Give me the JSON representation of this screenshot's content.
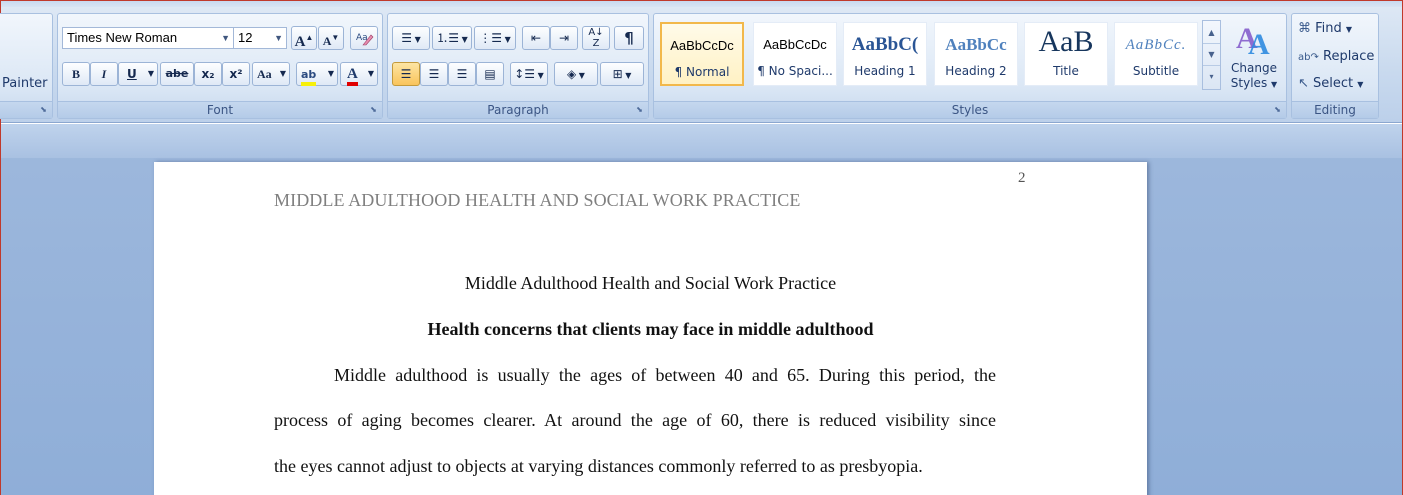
{
  "ribbon": {
    "clipboard": {
      "format_painter_label": "Painter"
    },
    "font": {
      "label": "Font",
      "font_name": "Times New Roman",
      "font_size": "12",
      "grow_label": "A",
      "shrink_label": "A",
      "bold_label": "B",
      "italic_label": "I",
      "underline_label": "U",
      "strikethrough_label": "abe",
      "subscript_label": "x₂",
      "superscript_label": "x²",
      "change_case_label": "Aa",
      "highlight_label": "ab",
      "font_color_label": "A",
      "highlight_color": "#f7f00a",
      "font_color": "#e00000"
    },
    "paragraph": {
      "label": "Paragraph",
      "pilcrow_label": "¶"
    },
    "styles": {
      "label": "Styles",
      "items": [
        {
          "sample": "AaBbCcDc",
          "name": "¶ Normal"
        },
        {
          "sample": "AaBbCcDc",
          "name": "¶ No Spaci..."
        },
        {
          "sample": "AaBbC(",
          "name": "Heading 1"
        },
        {
          "sample": "AaBbCc",
          "name": "Heading 2"
        },
        {
          "sample": "AaB",
          "name": "Title"
        },
        {
          "sample": "AaBbCc.",
          "name": "Subtitle"
        }
      ],
      "change_styles_line1": "Change",
      "change_styles_line2": "Styles"
    },
    "editing": {
      "label": "Editing",
      "find_label": "Find",
      "replace_label": "Replace",
      "select_label": "Select"
    }
  },
  "document": {
    "page_number": "2",
    "running_head": "MIDDLE ADULTHOOD HEALTH AND SOCIAL WORK PRACTICE",
    "title": "Middle Adulthood Health and Social Work Practice",
    "heading": "Health concerns that clients may face in middle adulthood",
    "lines": [
      "Middle adulthood is usually the ages of between 40 and 65. During this period, the",
      "process of aging becomes clearer. At around the age of 60, there is reduced visibility since",
      "the eyes cannot adjust to objects at varying distances commonly referred to as presbyopia."
    ]
  }
}
